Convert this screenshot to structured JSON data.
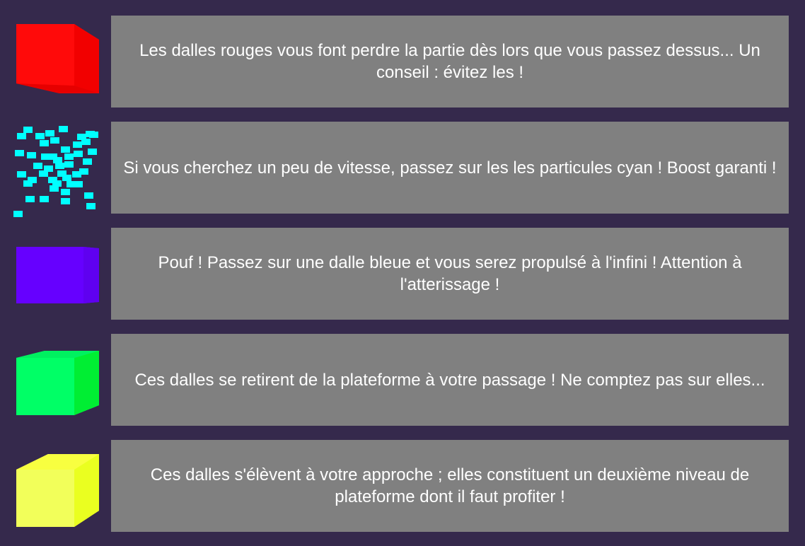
{
  "tiles": [
    {
      "id": "red",
      "icon": "red-cube-icon",
      "color": "#ff0000",
      "description": "Les dalles rouges vous font perdre la partie dès lors que vous passez dessus... Un conseil : évitez les !"
    },
    {
      "id": "cyan",
      "icon": "cyan-particles-icon",
      "color": "#00ffff",
      "description": "Si vous cherchez un peu de vitesse, passez sur les les particules cyan ! Boost garanti !"
    },
    {
      "id": "blue",
      "icon": "blue-cube-icon",
      "color": "#6600ff",
      "description": "Pouf ! Passez sur une dalle bleue et vous serez propulsé à l'infini ! Attention à l'atterissage !"
    },
    {
      "id": "green",
      "icon": "green-cube-icon",
      "color": "#00ff66",
      "description": "Ces dalles se retirent de la plateforme à votre passage ! Ne comptez pas sur elles..."
    },
    {
      "id": "yellow",
      "icon": "yellow-cube-icon",
      "color": "#f0ff30",
      "description": "Ces dalles s'élèvent à votre approche ; elles constituent un deuxième niveau de plateforme dont il faut profiter !"
    }
  ]
}
